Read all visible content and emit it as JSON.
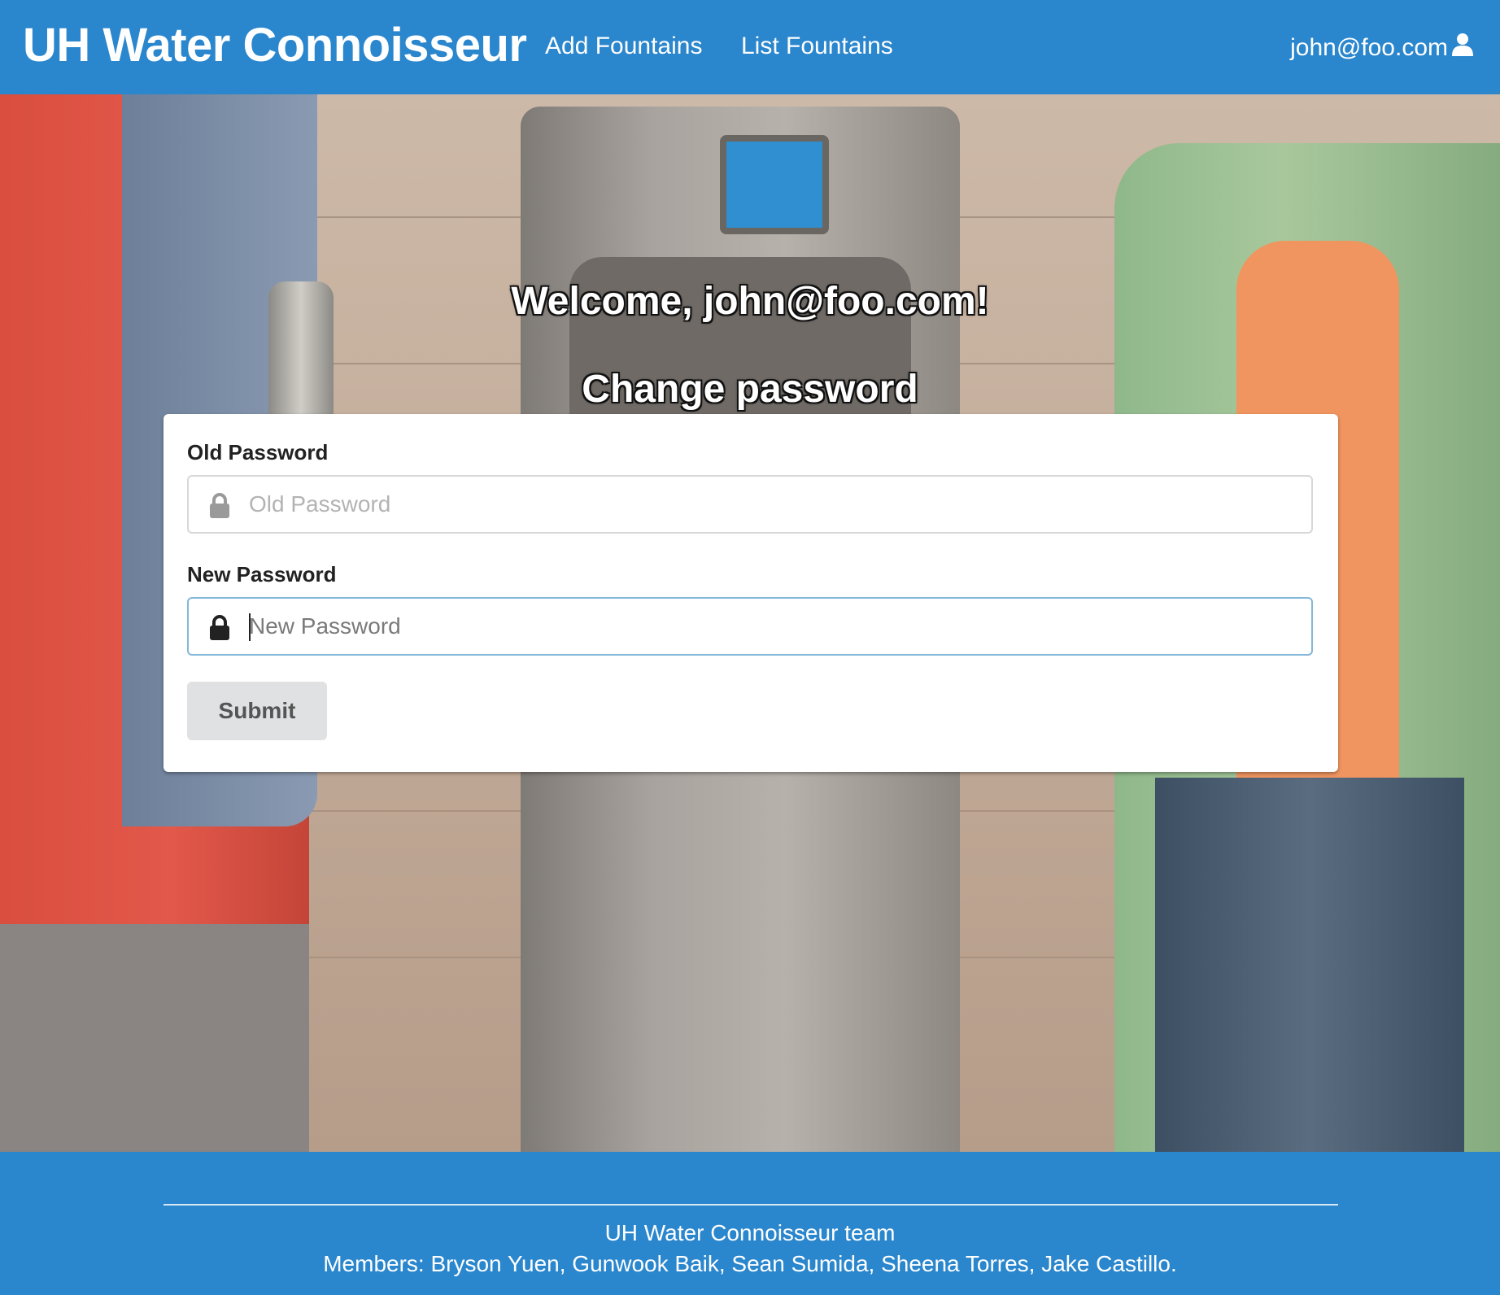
{
  "navbar": {
    "brand": "UH Water Connoisseur",
    "links": [
      {
        "label": "Add Fountains"
      },
      {
        "label": "List Fountains"
      }
    ],
    "user": {
      "email": "john@foo.com",
      "icon": "user-icon"
    }
  },
  "hero": {
    "welcome": "Welcome, john@foo.com!",
    "subtitle": "Change password"
  },
  "form": {
    "old_password": {
      "label": "Old Password",
      "placeholder": "Old Password",
      "value": "",
      "icon": "lock-icon"
    },
    "new_password": {
      "label": "New Password",
      "placeholder": "New Password",
      "value": "",
      "icon": "lock-icon"
    },
    "submit_label": "Submit"
  },
  "footer": {
    "team": "UH Water Connoisseur team",
    "members": "Members: Bryson Yuen, Gunwook Baik, Sean Sumida, Sheena Torres, Jake Castillo."
  },
  "colors": {
    "primary": "#2a86cd",
    "focus_border": "#85b7d9",
    "button_bg": "#e0e1e2"
  }
}
